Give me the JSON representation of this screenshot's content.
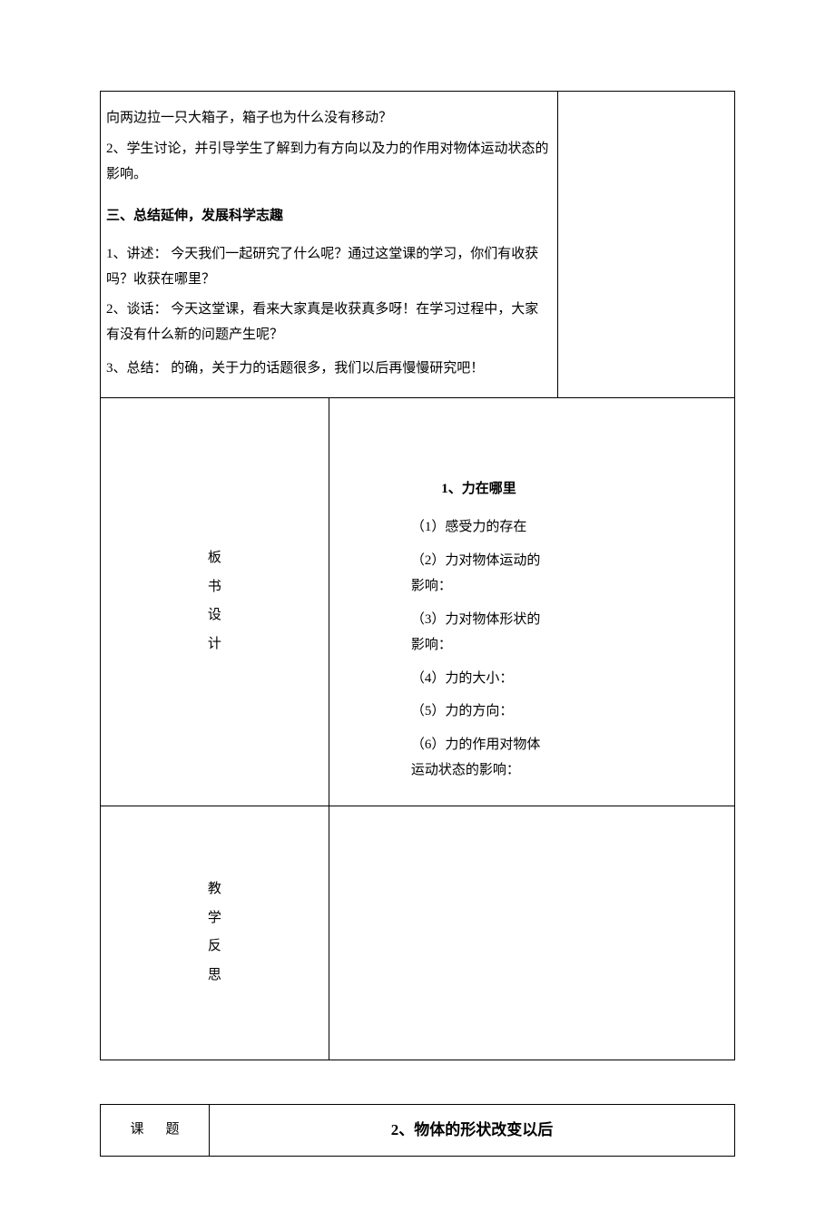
{
  "top": {
    "p1": "向两边拉一只大箱子，箱子也为什么没有移动？",
    "p2": "2、学生讨论，并引导学生了解到力有方向以及力的作用对物体运动状态的影响。",
    "section_heading": "三、总结延伸，发展科学志趣",
    "p3": "1、讲述：  今天我们一起研究了什么呢？通过这堂课的学习，你们有收获吗？收获在哪里？",
    "p4": "2、谈话：  今天这堂课，看来大家真是收获真多呀！在学习过程中，大家有没有什么新的问题产生呢？",
    "p5": "3、总结：  的确，关于力的话题很多，我们以后再慢慢研究吧！"
  },
  "board": {
    "label_c1": "板",
    "label_c2": "书",
    "label_c3": "设",
    "label_c4": "计",
    "title": "1、力在哪里",
    "l1": "（1）感受力的存在",
    "l2": "（2）力对物体运动的影响：",
    "l3": "（3）力对物体形状的影响：",
    "l4": "（4）力的大小：",
    "l5": "（5）力的方向：",
    "l6": "（6）力的作用对物体运动状态的影响："
  },
  "reflect": {
    "label_c1": "教",
    "label_c2": "学",
    "label_c3": "反",
    "label_c4": "思"
  },
  "table2": {
    "label": "课题",
    "content": "2、物体的形状改变以后"
  }
}
